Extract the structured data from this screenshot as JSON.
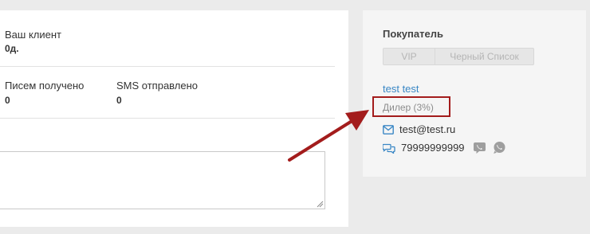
{
  "stats": {
    "client_since_label": "Ваш клиент",
    "client_since_value": "0д.",
    "emails_label": "Писем получено",
    "emails_value": "0",
    "sms_label": "SMS отправлено",
    "sms_value": "0"
  },
  "buyer": {
    "title": "Покупатель",
    "vip_label": "VIP",
    "blacklist_label": "Черный Список",
    "name": "test test",
    "discount": "Дилер (3%)",
    "email": "test@test.ru",
    "phone": "79999999999",
    "icons": {
      "email": "envelope-icon",
      "phone": "chat-bubbles-icon",
      "viber": "viber-icon",
      "whatsapp": "whatsapp-icon"
    }
  },
  "colors": {
    "link": "#3a87c5",
    "annotation": "#a31c1c",
    "panel_bg": "#f5f5f5",
    "page_bg": "#ebebeb"
  }
}
